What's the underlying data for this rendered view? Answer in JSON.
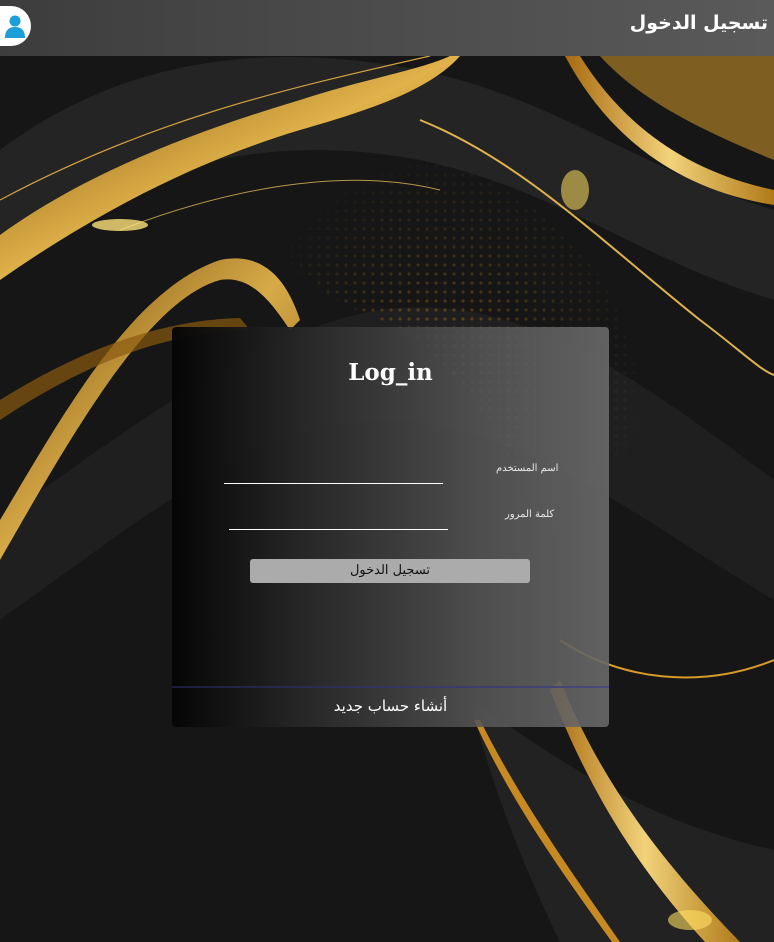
{
  "header": {
    "title": "تسجيل الدخول",
    "avatar_icon": "user-icon"
  },
  "login_form": {
    "title": "Log_in",
    "username_label": "اسم المستخدم",
    "username_value": "",
    "password_label": "كلمة المرور",
    "password_value": "",
    "submit_label": "تسجيل الدخول",
    "register_label": "أنشاء حساب جديد"
  },
  "colors": {
    "topbar": "#4c4c4c",
    "accent_gold": "#d4a23a",
    "avatar_icon": "#1a9fd8",
    "button": "#ababab"
  }
}
